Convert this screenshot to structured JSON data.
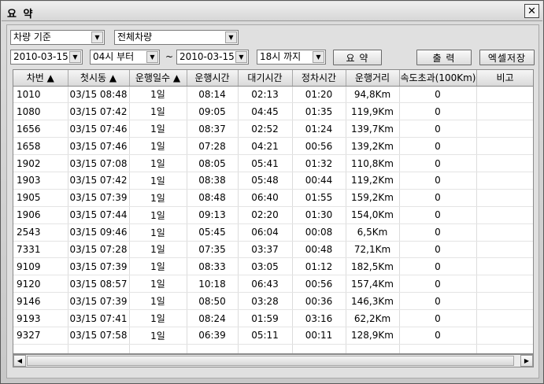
{
  "window": {
    "title": "요 약"
  },
  "filters": {
    "basis": "차량 기준",
    "vehicles": "전체차량",
    "start_date": "2010-03-15",
    "start_hour": "04시 부터",
    "separator": "~",
    "end_date": "2010-03-15",
    "end_hour": "18시 까지"
  },
  "buttons": {
    "summary": "요 약",
    "print": "출 력",
    "excel": "엑셀저장"
  },
  "table": {
    "headers": [
      "차번 ▲",
      "첫시동 ▲",
      "운행일수 ▲",
      "운행시간",
      "대기시간",
      "정차시간",
      "운행거리",
      "속도초과(100Km)",
      "비고"
    ],
    "rows": [
      [
        "1010",
        "03/15 08:48",
        "1일",
        "08:14",
        "02:13",
        "01:20",
        "94,8Km",
        "0",
        ""
      ],
      [
        "1080",
        "03/15 07:42",
        "1일",
        "09:05",
        "04:45",
        "01:35",
        "119,9Km",
        "0",
        ""
      ],
      [
        "1656",
        "03/15 07:46",
        "1일",
        "08:37",
        "02:52",
        "01:24",
        "139,7Km",
        "0",
        ""
      ],
      [
        "1658",
        "03/15 07:46",
        "1일",
        "07:28",
        "04:21",
        "00:56",
        "139,2Km",
        "0",
        ""
      ],
      [
        "1902",
        "03/15 07:08",
        "1일",
        "08:05",
        "05:41",
        "01:32",
        "110,8Km",
        "0",
        ""
      ],
      [
        "1903",
        "03/15 07:42",
        "1일",
        "08:38",
        "05:48",
        "00:44",
        "119,2Km",
        "0",
        ""
      ],
      [
        "1905",
        "03/15 07:39",
        "1일",
        "08:48",
        "06:40",
        "01:55",
        "159,2Km",
        "0",
        ""
      ],
      [
        "1906",
        "03/15 07:44",
        "1일",
        "09:13",
        "02:20",
        "01:30",
        "154,0Km",
        "0",
        ""
      ],
      [
        "2543",
        "03/15 09:46",
        "1일",
        "05:45",
        "06:04",
        "00:08",
        "6,5Km",
        "0",
        ""
      ],
      [
        "7331",
        "03/15 07:28",
        "1일",
        "07:35",
        "03:37",
        "00:48",
        "72,1Km",
        "0",
        ""
      ],
      [
        "9109",
        "03/15 07:39",
        "1일",
        "08:33",
        "03:05",
        "01:12",
        "182,5Km",
        "0",
        ""
      ],
      [
        "9120",
        "03/15 08:57",
        "1일",
        "10:18",
        "06:43",
        "00:56",
        "157,4Km",
        "0",
        ""
      ],
      [
        "9146",
        "03/15 07:39",
        "1일",
        "08:50",
        "03:28",
        "00:36",
        "146,3Km",
        "0",
        ""
      ],
      [
        "9193",
        "03/15 07:41",
        "1일",
        "08:24",
        "01:59",
        "03:16",
        "62,2Km",
        "0",
        ""
      ],
      [
        "9327",
        "03/15 07:58",
        "1일",
        "06:39",
        "05:11",
        "00:11",
        "128,9Km",
        "0",
        ""
      ],
      [
        "",
        "",
        "",
        "",
        "",
        "",
        "",
        "",
        ""
      ]
    ]
  },
  "icons": {
    "close": "close-icon",
    "dropdown": "chevron-down-icon",
    "scroll_left": "arrow-left-icon",
    "scroll_right": "arrow-right-icon"
  }
}
